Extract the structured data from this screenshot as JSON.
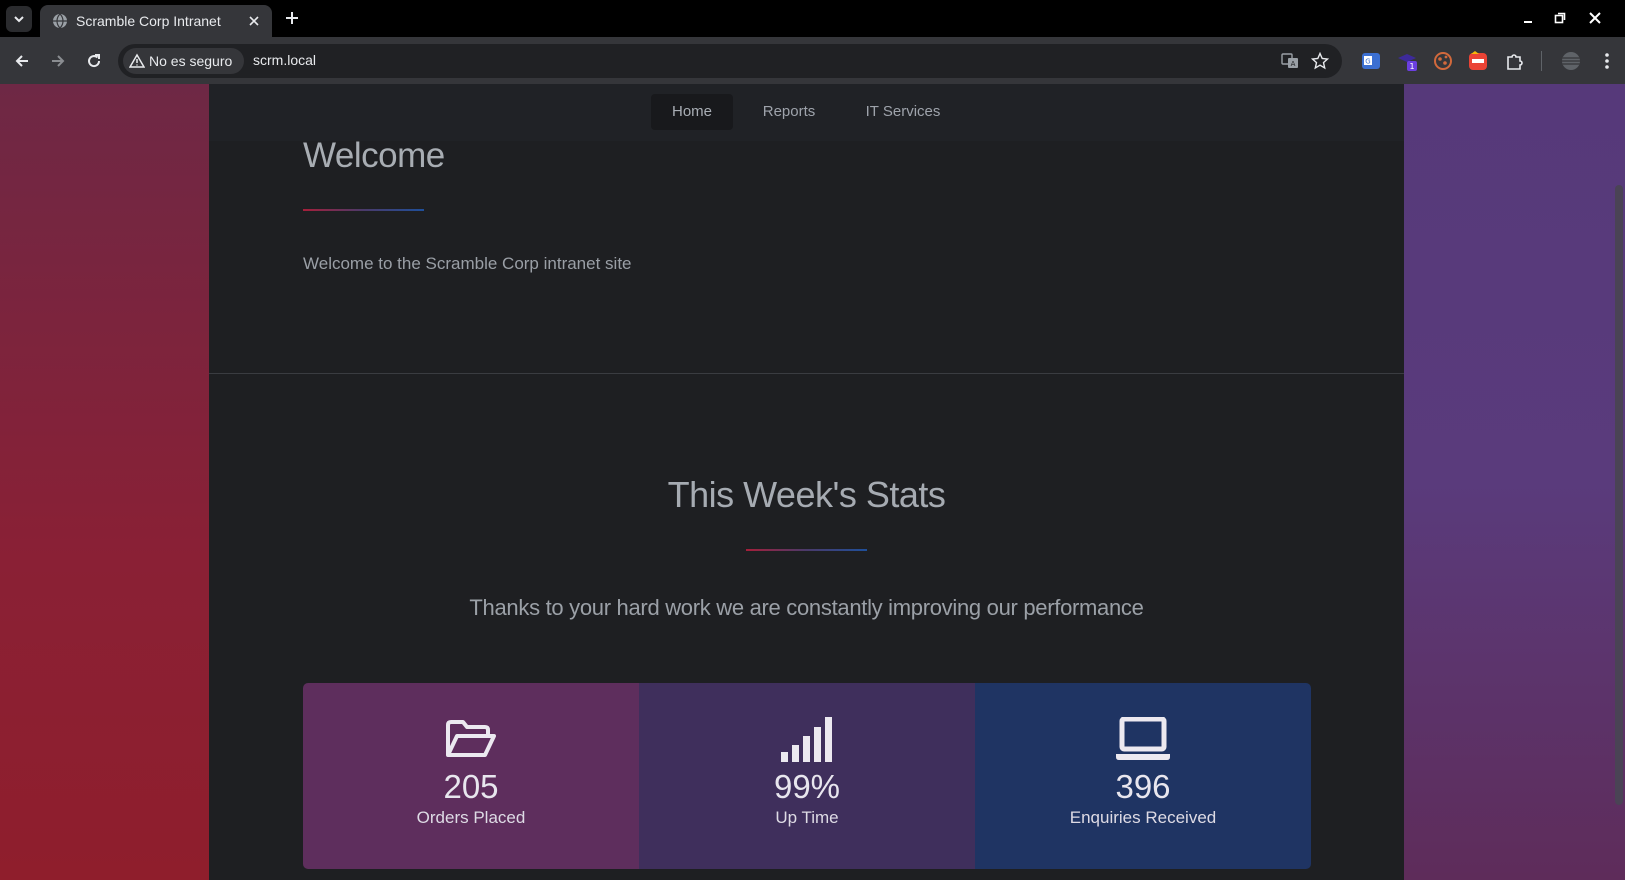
{
  "browser": {
    "tab_title": "Scramble Corp Intranet",
    "security_label": "No es seguro",
    "url": "scrm.local"
  },
  "nav": {
    "items": [
      {
        "label": "Home",
        "active": true
      },
      {
        "label": "Reports",
        "active": false
      },
      {
        "label": "IT Services",
        "active": false
      }
    ]
  },
  "welcome": {
    "title": "Welcome",
    "text": "Welcome to the Scramble Corp intranet site"
  },
  "stats": {
    "title": "This Week's Stats",
    "subtitle": "Thanks to your hard work we are constantly improving our performance",
    "cards": [
      {
        "icon": "folder-open-icon",
        "value": "205",
        "label": "Orders Placed",
        "color": "#5e2e5d"
      },
      {
        "icon": "signal-bars-icon",
        "value": "99%",
        "label": "Up Time",
        "color": "#3f2f5c"
      },
      {
        "icon": "laptop-icon",
        "value": "396",
        "label": "Enquiries Received",
        "color": "#1f3463"
      }
    ]
  },
  "colors": {
    "underline_start": "#a51f3a",
    "underline_end": "#1f4f9a",
    "page_bg": "#1e1f22"
  }
}
